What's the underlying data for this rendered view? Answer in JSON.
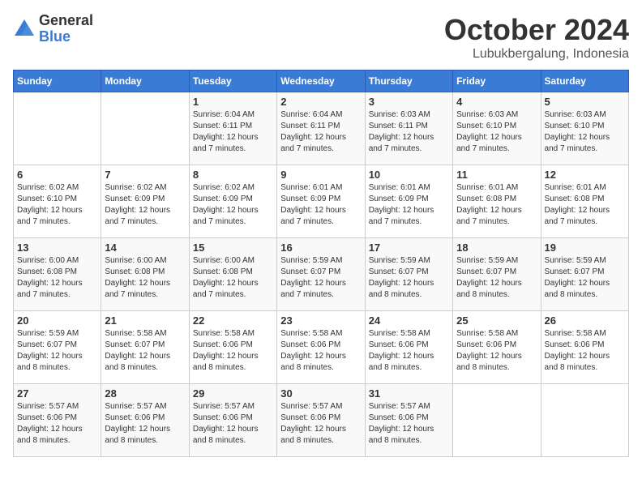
{
  "logo": {
    "general": "General",
    "blue": "Blue"
  },
  "title": "October 2024",
  "subtitle": "Lubukbergalung, Indonesia",
  "days_of_week": [
    "Sunday",
    "Monday",
    "Tuesday",
    "Wednesday",
    "Thursday",
    "Friday",
    "Saturday"
  ],
  "weeks": [
    [
      {
        "day": "",
        "info": ""
      },
      {
        "day": "",
        "info": ""
      },
      {
        "day": "1",
        "info": "Sunrise: 6:04 AM\nSunset: 6:11 PM\nDaylight: 12 hours and 7 minutes."
      },
      {
        "day": "2",
        "info": "Sunrise: 6:04 AM\nSunset: 6:11 PM\nDaylight: 12 hours and 7 minutes."
      },
      {
        "day": "3",
        "info": "Sunrise: 6:03 AM\nSunset: 6:11 PM\nDaylight: 12 hours and 7 minutes."
      },
      {
        "day": "4",
        "info": "Sunrise: 6:03 AM\nSunset: 6:10 PM\nDaylight: 12 hours and 7 minutes."
      },
      {
        "day": "5",
        "info": "Sunrise: 6:03 AM\nSunset: 6:10 PM\nDaylight: 12 hours and 7 minutes."
      }
    ],
    [
      {
        "day": "6",
        "info": "Sunrise: 6:02 AM\nSunset: 6:10 PM\nDaylight: 12 hours and 7 minutes."
      },
      {
        "day": "7",
        "info": "Sunrise: 6:02 AM\nSunset: 6:09 PM\nDaylight: 12 hours and 7 minutes."
      },
      {
        "day": "8",
        "info": "Sunrise: 6:02 AM\nSunset: 6:09 PM\nDaylight: 12 hours and 7 minutes."
      },
      {
        "day": "9",
        "info": "Sunrise: 6:01 AM\nSunset: 6:09 PM\nDaylight: 12 hours and 7 minutes."
      },
      {
        "day": "10",
        "info": "Sunrise: 6:01 AM\nSunset: 6:09 PM\nDaylight: 12 hours and 7 minutes."
      },
      {
        "day": "11",
        "info": "Sunrise: 6:01 AM\nSunset: 6:08 PM\nDaylight: 12 hours and 7 minutes."
      },
      {
        "day": "12",
        "info": "Sunrise: 6:01 AM\nSunset: 6:08 PM\nDaylight: 12 hours and 7 minutes."
      }
    ],
    [
      {
        "day": "13",
        "info": "Sunrise: 6:00 AM\nSunset: 6:08 PM\nDaylight: 12 hours and 7 minutes."
      },
      {
        "day": "14",
        "info": "Sunrise: 6:00 AM\nSunset: 6:08 PM\nDaylight: 12 hours and 7 minutes."
      },
      {
        "day": "15",
        "info": "Sunrise: 6:00 AM\nSunset: 6:08 PM\nDaylight: 12 hours and 7 minutes."
      },
      {
        "day": "16",
        "info": "Sunrise: 5:59 AM\nSunset: 6:07 PM\nDaylight: 12 hours and 7 minutes."
      },
      {
        "day": "17",
        "info": "Sunrise: 5:59 AM\nSunset: 6:07 PM\nDaylight: 12 hours and 8 minutes."
      },
      {
        "day": "18",
        "info": "Sunrise: 5:59 AM\nSunset: 6:07 PM\nDaylight: 12 hours and 8 minutes."
      },
      {
        "day": "19",
        "info": "Sunrise: 5:59 AM\nSunset: 6:07 PM\nDaylight: 12 hours and 8 minutes."
      }
    ],
    [
      {
        "day": "20",
        "info": "Sunrise: 5:59 AM\nSunset: 6:07 PM\nDaylight: 12 hours and 8 minutes."
      },
      {
        "day": "21",
        "info": "Sunrise: 5:58 AM\nSunset: 6:07 PM\nDaylight: 12 hours and 8 minutes."
      },
      {
        "day": "22",
        "info": "Sunrise: 5:58 AM\nSunset: 6:06 PM\nDaylight: 12 hours and 8 minutes."
      },
      {
        "day": "23",
        "info": "Sunrise: 5:58 AM\nSunset: 6:06 PM\nDaylight: 12 hours and 8 minutes."
      },
      {
        "day": "24",
        "info": "Sunrise: 5:58 AM\nSunset: 6:06 PM\nDaylight: 12 hours and 8 minutes."
      },
      {
        "day": "25",
        "info": "Sunrise: 5:58 AM\nSunset: 6:06 PM\nDaylight: 12 hours and 8 minutes."
      },
      {
        "day": "26",
        "info": "Sunrise: 5:58 AM\nSunset: 6:06 PM\nDaylight: 12 hours and 8 minutes."
      }
    ],
    [
      {
        "day": "27",
        "info": "Sunrise: 5:57 AM\nSunset: 6:06 PM\nDaylight: 12 hours and 8 minutes."
      },
      {
        "day": "28",
        "info": "Sunrise: 5:57 AM\nSunset: 6:06 PM\nDaylight: 12 hours and 8 minutes."
      },
      {
        "day": "29",
        "info": "Sunrise: 5:57 AM\nSunset: 6:06 PM\nDaylight: 12 hours and 8 minutes."
      },
      {
        "day": "30",
        "info": "Sunrise: 5:57 AM\nSunset: 6:06 PM\nDaylight: 12 hours and 8 minutes."
      },
      {
        "day": "31",
        "info": "Sunrise: 5:57 AM\nSunset: 6:06 PM\nDaylight: 12 hours and 8 minutes."
      },
      {
        "day": "",
        "info": ""
      },
      {
        "day": "",
        "info": ""
      }
    ]
  ]
}
